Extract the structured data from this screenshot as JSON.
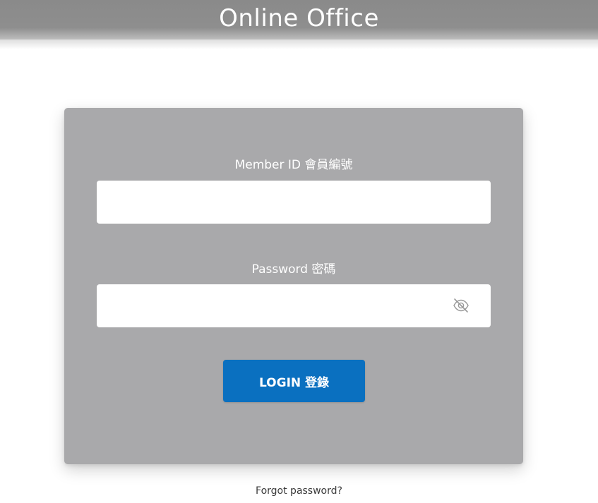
{
  "header": {
    "title": "Online Office"
  },
  "form": {
    "member_id_label": "Member ID 會員編號",
    "member_id_value": "",
    "password_label": "Password 密碼",
    "password_value": "",
    "password_toggle_icon": "eye-slash-icon",
    "login_label": "LOGIN 登錄",
    "forgot_label": "Forgot password?"
  },
  "colors": {
    "header_bg": "#8a8a8a",
    "card_bg": "#a9a9ab",
    "login_button": "#0a70c0",
    "icon": "#9a9a9a"
  }
}
